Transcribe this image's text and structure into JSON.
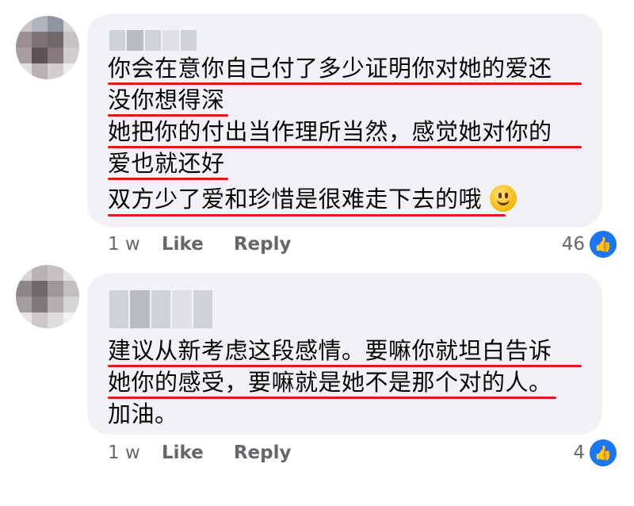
{
  "comments": [
    {
      "lines": [
        "你会在意你自己付了多少证明你对她的爱还",
        "没你想得深",
        "她把你的付出当作理所当然，感觉她对你的",
        "爱也就还好",
        "双方少了爱和珍惜是很难走下去的哦"
      ],
      "time": "1 w",
      "like_label": "Like",
      "reply_label": "Reply",
      "reaction_count": "46"
    },
    {
      "lines": [
        "建议从新考虑这段感情。要嘛你就坦白告诉",
        "她你的感受，要嘛就是她不是那个对的人。",
        "加油。"
      ],
      "time": "1 w",
      "like_label": "Like",
      "reply_label": "Reply",
      "reaction_count": "4"
    }
  ],
  "colors": {
    "bubble": "#f0f2f5",
    "underline": "#e01919",
    "meta_text": "#65676b",
    "reaction_blue": "#1877f2"
  },
  "icons": [
    "slightly-smiling-face-emoji",
    "thumbs-up-icon"
  ]
}
